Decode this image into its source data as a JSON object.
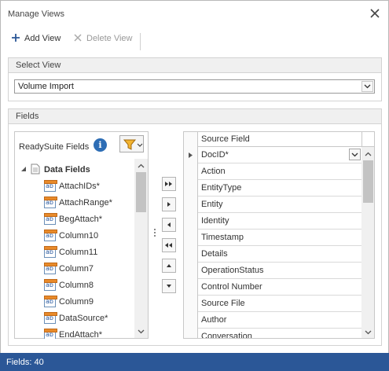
{
  "window": {
    "title": "Manage Views"
  },
  "toolbar": {
    "add_label": "Add View",
    "delete_label": "Delete View"
  },
  "select_view": {
    "header": "Select View",
    "value": "Volume Import"
  },
  "fields": {
    "header": "Fields",
    "left_title": "ReadySuite Fields",
    "root_label": "Data Fields",
    "items": [
      "AttachIDs*",
      "AttachRange*",
      "BegAttach*",
      "Column10",
      "Column11",
      "Column7",
      "Column8",
      "Column9",
      "DataSource*",
      "EndAttach*"
    ],
    "source_header": "Source Field",
    "source_rows": [
      "DocID*",
      "Action",
      "EntityType",
      "Entity",
      "Identity",
      "Timestamp",
      "Details",
      "OperationStatus",
      "Control Number",
      "Source File",
      "Author",
      "Conversation"
    ]
  },
  "status": {
    "text": "Fields: 40"
  },
  "colors": {
    "status_bar": "#2b5797",
    "info": "#2d6db5",
    "filter": "#e8a020"
  }
}
